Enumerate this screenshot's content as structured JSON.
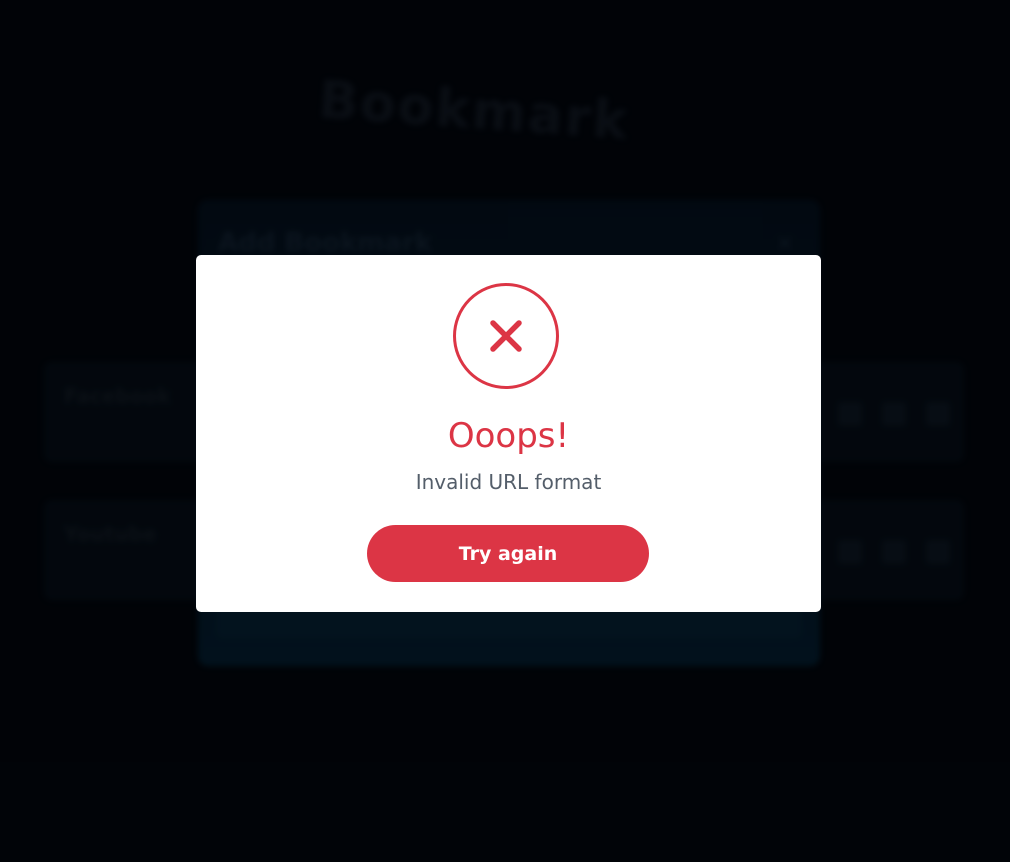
{
  "background": {
    "logo": "Bookmark",
    "tagline": "",
    "cards": [
      {
        "title": "Facebook",
        "subtitle": ""
      },
      {
        "title": "Youtube",
        "subtitle": ""
      }
    ],
    "add_modal": {
      "title": "Add Bookmark",
      "close_icon": "close-icon"
    }
  },
  "alert": {
    "icon": "error-x-icon",
    "title": "Ooops!",
    "message": "Invalid URL format",
    "button_label": "Try again"
  },
  "colors": {
    "accent": "#dc3545",
    "message_text": "#545e6a",
    "dialog_bg": "#ffffff",
    "page_bg": "#02060c"
  }
}
